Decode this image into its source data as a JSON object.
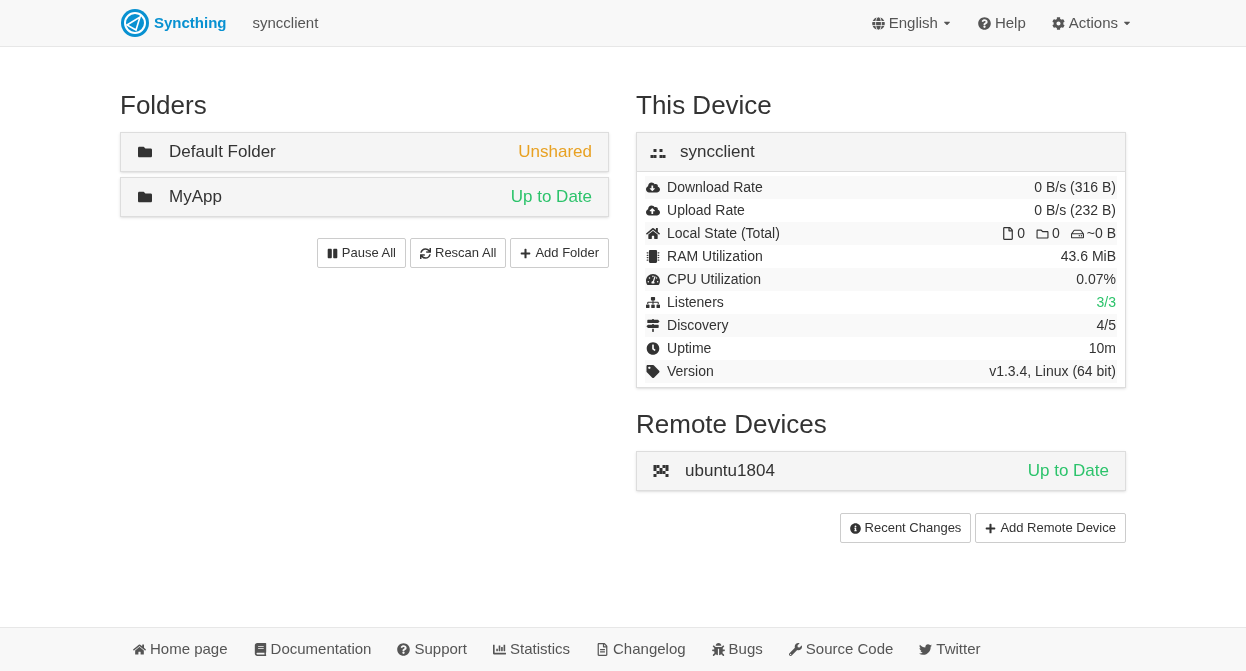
{
  "navbar": {
    "brand": "Syncthing",
    "device_name": "syncclient",
    "menu": [
      {
        "label": "English",
        "dropdown": true
      },
      {
        "label": "Help",
        "dropdown": false
      },
      {
        "label": "Actions",
        "dropdown": true
      }
    ]
  },
  "folders": {
    "title": "Folders",
    "items": [
      {
        "name": "Default Folder",
        "status": "Unshared",
        "color": "#e8a122"
      },
      {
        "name": "MyApp",
        "status": "Up to Date",
        "color": "#2cc36b"
      }
    ],
    "buttons": [
      "Pause All",
      "Rescan All",
      "Add Folder"
    ]
  },
  "this_device": {
    "title": "This Device",
    "name": "syncclient",
    "rows": [
      {
        "label": "Download Rate",
        "kind": "text",
        "value": "0 B/s (316 B)"
      },
      {
        "label": "Upload Rate",
        "kind": "text",
        "value": "0 B/s (232 B)"
      },
      {
        "label": "Local State (Total)",
        "kind": "counts",
        "files": "0",
        "folders": "0",
        "size": "~0 B"
      },
      {
        "label": "RAM Utilization",
        "kind": "text",
        "value": "43.6 MiB"
      },
      {
        "label": "CPU Utilization",
        "kind": "text",
        "value": "0.07%"
      },
      {
        "label": "Listeners",
        "kind": "ok",
        "value": "3/3"
      },
      {
        "label": "Discovery",
        "kind": "text",
        "value": "4/5"
      },
      {
        "label": "Uptime",
        "kind": "text",
        "value": "10m"
      },
      {
        "label": "Version",
        "kind": "text",
        "value": "v1.3.4, Linux (64 bit)"
      }
    ]
  },
  "remote_devices": {
    "title": "Remote Devices",
    "items": [
      {
        "name": "ubuntu1804",
        "status": "Up to Date",
        "color": "#2cc36b"
      }
    ],
    "buttons": [
      "Recent Changes",
      "Add Remote Device"
    ]
  },
  "footer": [
    "Home page",
    "Documentation",
    "Support",
    "Statistics",
    "Changelog",
    "Bugs",
    "Source Code",
    "Twitter"
  ]
}
